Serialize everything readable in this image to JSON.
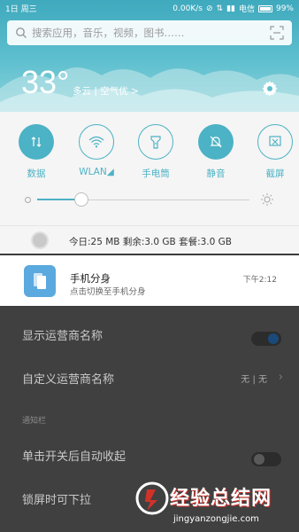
{
  "status_bar": {
    "left_text": "1日 周三",
    "speed": "0.00K/s",
    "carrier": "电信",
    "battery_percent": "99%"
  },
  "search": {
    "placeholder": "搜索应用，音乐，视频，图书……"
  },
  "weather": {
    "temperature": "33°",
    "condition": "多云 | 空气优 >"
  },
  "quick_settings": {
    "tiles": [
      {
        "label": "数据",
        "state": "on",
        "icon": "mobile-data-icon"
      },
      {
        "label": "WLAN◢",
        "state": "off",
        "icon": "wifi-icon"
      },
      {
        "label": "手电筒",
        "state": "off",
        "icon": "flashlight-icon"
      },
      {
        "label": "静音",
        "state": "on",
        "icon": "mute-bell-icon"
      },
      {
        "label": "截屏",
        "state": "off",
        "icon": "screenshot-icon"
      }
    ],
    "brightness_level": 0.21,
    "data_usage": "今日:25 MB   剩余:3.0 GB   套餐:3.0 GB"
  },
  "notification": {
    "title": "手机分身",
    "subtitle": "点击切换至手机分身",
    "time": "下午2:12"
  },
  "background_settings": {
    "show_carrier_name": "显示运营商名称",
    "custom_carrier_name": "自定义运营商名称",
    "custom_carrier_value": "无 | 无",
    "section_notifications": "通知栏",
    "auto_collapse": "单击开关后自动收起",
    "lockscreen_pulldown": "锁屏时可下拉"
  },
  "watermark": {
    "text": "经验总结网",
    "url": "jingyanzongjie.com"
  },
  "colors": {
    "accent": "#4cb2c5",
    "header_top": "#3fa9bd",
    "panel_bg": "#f5f5f5"
  }
}
